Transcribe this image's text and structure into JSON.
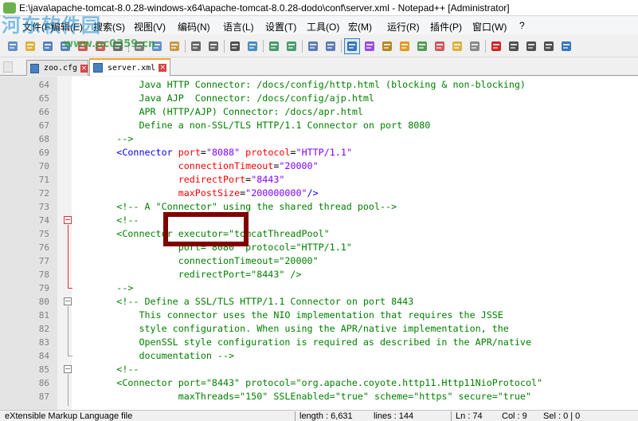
{
  "window": {
    "title": "E:\\java\\apache-tomcat-8.0.28-windows-x64\\apache-tomcat-8.0.28-dodo\\conf\\server.xml - Notepad++ [Administrator]"
  },
  "watermark": {
    "brand": "河东软件园",
    "url": "www.pc0359.cn"
  },
  "menu": {
    "items": [
      "文件(F)",
      "编辑(E)",
      "搜索(S)",
      "视图(V)",
      "编码(N)",
      "语言(L)",
      "设置(T)",
      "工具(O)",
      "宏(M)",
      "运行(R)",
      "插件(P)",
      "窗口(W)",
      "?"
    ]
  },
  "toolbar": {
    "buttons": [
      "new-file-icon",
      "open-file-icon",
      "save-icon",
      "save-all-icon",
      "close-icon",
      "close-all-icon",
      "print-icon",
      "cut-icon",
      "copy-icon",
      "paste-icon",
      "undo-icon",
      "redo-icon",
      "find-icon",
      "replace-icon",
      "zoom-in-icon",
      "zoom-out-icon",
      "sync-vertical-icon",
      "sync-horizontal-icon",
      "word-wrap-icon",
      "show-all-chars-icon",
      "indent-guide-icon",
      "language-icon",
      "doc-map-icon",
      "function-list-icon",
      "folder-workspace-icon",
      "monitor-icon",
      "record-macro-icon",
      "stop-macro-icon",
      "play-macro-icon",
      "run-macro-multiple-icon",
      "save-macro-icon"
    ]
  },
  "tabs": [
    {
      "label": "zoo.cfg",
      "active": false
    },
    {
      "label": "server.xml",
      "active": true
    }
  ],
  "editor": {
    "lines": [
      {
        "num": "64",
        "segments": [
          {
            "t": "            Java HTTP Connector: /docs/config/http.html (blocking & non-blocking)",
            "c": "comment"
          }
        ]
      },
      {
        "num": "65",
        "segments": [
          {
            "t": "            Java AJP  Connector: /docs/config/ajp.html",
            "c": "comment"
          }
        ]
      },
      {
        "num": "66",
        "segments": [
          {
            "t": "            APR (HTTP/AJP) Connector: /docs/apr.html",
            "c": "comment"
          }
        ]
      },
      {
        "num": "67",
        "segments": [
          {
            "t": "            Define a non-SSL/TLS HTTP/1.1 Connector on port 8080",
            "c": "comment"
          }
        ]
      },
      {
        "num": "68",
        "segments": [
          {
            "t": "        -->",
            "c": "comment"
          }
        ]
      },
      {
        "num": "69",
        "segments": [
          {
            "t": "        <Connector ",
            "c": "tag"
          },
          {
            "t": "port",
            "c": "attr"
          },
          {
            "t": "=",
            "c": "plain"
          },
          {
            "t": "\"8088\"",
            "c": "val"
          },
          {
            "t": " protocol",
            "c": "attr"
          },
          {
            "t": "=",
            "c": "plain"
          },
          {
            "t": "\"HTTP/1.1\"",
            "c": "val"
          }
        ]
      },
      {
        "num": "70",
        "segments": [
          {
            "t": "                   connectionTimeout",
            "c": "attr"
          },
          {
            "t": "=",
            "c": "plain"
          },
          {
            "t": "\"20000\"",
            "c": "val"
          }
        ]
      },
      {
        "num": "71",
        "segments": [
          {
            "t": "                   redirectPort",
            "c": "attr"
          },
          {
            "t": "=",
            "c": "plain"
          },
          {
            "t": "\"8443\"",
            "c": "val"
          }
        ]
      },
      {
        "num": "72",
        "segments": [
          {
            "t": "                   maxPostSize",
            "c": "attr"
          },
          {
            "t": "=",
            "c": "plain"
          },
          {
            "t": "\"200000000\"",
            "c": "val"
          },
          {
            "t": "/>",
            "c": "tag"
          }
        ]
      },
      {
        "num": "73",
        "segments": [
          {
            "t": "        <!-- A \"Connector\" using the shared thread pool-->",
            "c": "comment"
          }
        ]
      },
      {
        "num": "74",
        "segments": [
          {
            "t": "        <!--",
            "c": "comment"
          }
        ]
      },
      {
        "num": "75",
        "segments": [
          {
            "t": "        <Connector executor=\"tomcatThreadPool\"",
            "c": "comment"
          }
        ]
      },
      {
        "num": "76",
        "segments": [
          {
            "t": "                   port=\"8080\" protocol=\"HTTP/1.1\"",
            "c": "comment"
          }
        ]
      },
      {
        "num": "77",
        "segments": [
          {
            "t": "                   connectionTimeout=\"20000\"",
            "c": "comment"
          }
        ]
      },
      {
        "num": "78",
        "segments": [
          {
            "t": "                   redirectPort=\"8443\" />",
            "c": "comment"
          }
        ]
      },
      {
        "num": "79",
        "segments": [
          {
            "t": "        -->",
            "c": "comment"
          }
        ]
      },
      {
        "num": "80",
        "segments": [
          {
            "t": "        <!-- Define a SSL/TLS HTTP/1.1 Connector on port 8443",
            "c": "comment"
          }
        ]
      },
      {
        "num": "81",
        "segments": [
          {
            "t": "            This connector uses the NIO implementation that requires the JSSE",
            "c": "comment"
          }
        ]
      },
      {
        "num": "82",
        "segments": [
          {
            "t": "            style configuration. When using the APR/native implementation, the",
            "c": "comment"
          }
        ]
      },
      {
        "num": "83",
        "segments": [
          {
            "t": "            OpenSSL style configuration is required as described in the APR/native",
            "c": "comment"
          }
        ]
      },
      {
        "num": "84",
        "segments": [
          {
            "t": "            documentation -->",
            "c": "comment"
          }
        ]
      },
      {
        "num": "85",
        "segments": [
          {
            "t": "        <!--",
            "c": "comment"
          }
        ]
      },
      {
        "num": "86",
        "segments": [
          {
            "t": "        <Connector port=\"8443\" protocol=\"org.apache.coyote.http11.Http11NioProtocol\"",
            "c": "comment"
          }
        ]
      },
      {
        "num": "87",
        "segments": [
          {
            "t": "                   maxThreads=\"150\" SSLEnabled=\"true\" scheme=\"https\" secure=\"true\"",
            "c": "comment"
          }
        ]
      }
    ]
  },
  "status": {
    "filetype": "eXtensible Markup Language file",
    "length": "length : 6,631",
    "lines": "lines : 144",
    "ln": "Ln : 74",
    "col": "Col : 9",
    "sel": "Sel : 0 | 0"
  }
}
